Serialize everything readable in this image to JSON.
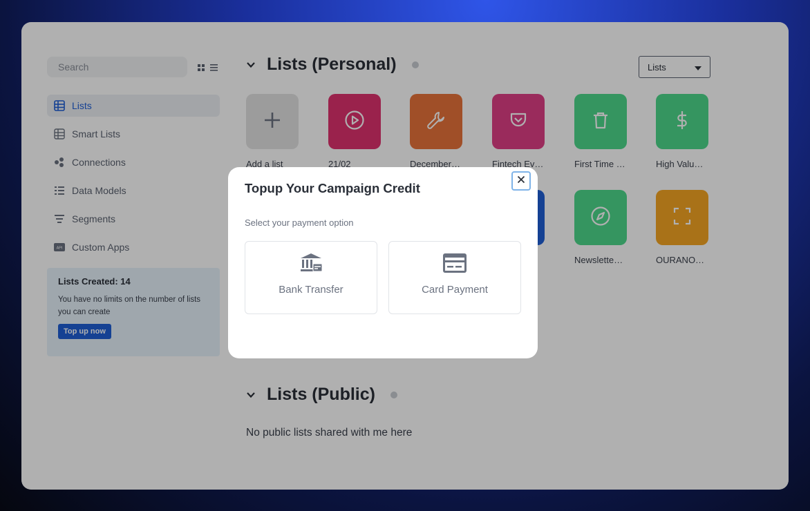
{
  "sidebar": {
    "search_placeholder": "Search",
    "items": [
      {
        "label": "Lists",
        "icon": "table-icon",
        "active": true
      },
      {
        "label": "Smart Lists",
        "icon": "table-icon"
      },
      {
        "label": "Connections",
        "icon": "connections-icon"
      },
      {
        "label": "Data Models",
        "icon": "data-models-icon"
      },
      {
        "label": "Segments",
        "icon": "segments-icon"
      },
      {
        "label": "Custom Apps",
        "icon": "api-icon"
      }
    ],
    "credit": {
      "title": "Lists Created: 14",
      "text": "You have no limits on the number of lists you can create",
      "button": "Top up now"
    }
  },
  "personal": {
    "title": "Lists (Personal)",
    "select_value": "Lists",
    "tiles": [
      {
        "label": "Add a list",
        "color": "#e2e2e2",
        "icon": "plus-icon"
      },
      {
        "label": "21/02",
        "color": "#e0326e",
        "icon": "play-circle-icon"
      },
      {
        "label": "December…",
        "color": "#e8733a",
        "icon": "wrench-icon"
      },
      {
        "label": "Fintech Ev…",
        "color": "#e03f86",
        "icon": "pocket-icon"
      },
      {
        "label": "First Time …",
        "color": "#4dd88c",
        "icon": "trash-icon"
      },
      {
        "label": "High Valu…",
        "color": "#4dd88c",
        "icon": "dollar-icon"
      },
      {
        "label": "Newslette…",
        "color": "#4dd88c",
        "icon": "compass-icon"
      },
      {
        "label": "OURANO…",
        "color": "#f5a623",
        "icon": "maximize-icon"
      }
    ]
  },
  "public": {
    "title": "Lists (Public)",
    "empty_text": "No public lists shared with me here"
  },
  "modal": {
    "title": "Topup Your Campaign Credit",
    "subtitle": "Select your payment option",
    "options": [
      {
        "label": "Bank Transfer",
        "icon": "bank-icon"
      },
      {
        "label": "Card Payment",
        "icon": "credit-card-icon"
      }
    ],
    "close_symbol": "×"
  },
  "colors": {
    "accent": "#1f5fd6",
    "overlay": "rgba(0,0,0,0.31)"
  }
}
